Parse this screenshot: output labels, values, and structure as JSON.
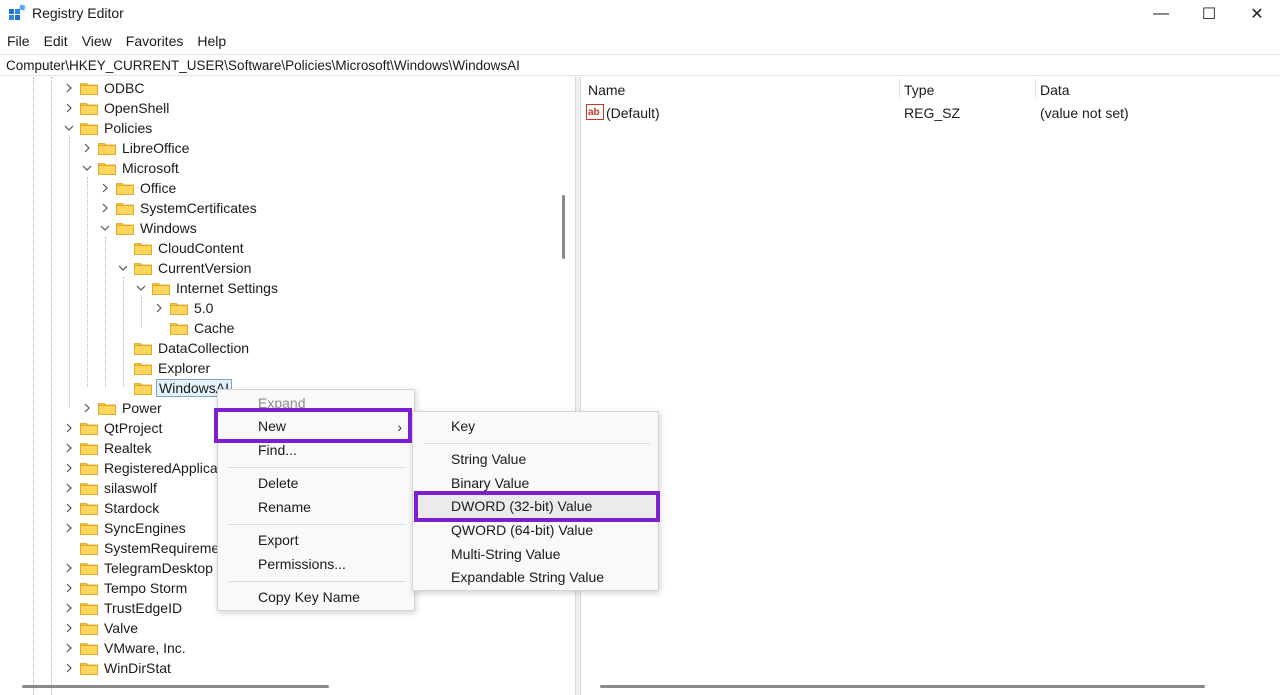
{
  "window": {
    "title": "Registry Editor",
    "controls": {
      "minimize": "—",
      "maximize": "☐",
      "close": "✕"
    }
  },
  "menubar": [
    "File",
    "Edit",
    "View",
    "Favorites",
    "Help"
  ],
  "address": "Computer\\HKEY_CURRENT_USER\\Software\\Policies\\Microsoft\\Windows\\WindowsAI",
  "tree": [
    {
      "label": "ODBC",
      "chevron": "right"
    },
    {
      "label": "OpenShell",
      "chevron": "right"
    },
    {
      "label": "Policies",
      "chevron": "down"
    },
    {
      "label": "LibreOffice",
      "chevron": "right"
    },
    {
      "label": "Microsoft",
      "chevron": "down"
    },
    {
      "label": "Office",
      "chevron": "right"
    },
    {
      "label": "SystemCertificates",
      "chevron": "right"
    },
    {
      "label": "Windows",
      "chevron": "down"
    },
    {
      "label": "CloudContent",
      "chevron": "none"
    },
    {
      "label": "CurrentVersion",
      "chevron": "down"
    },
    {
      "label": "Internet Settings",
      "chevron": "down"
    },
    {
      "label": "5.0",
      "chevron": "right"
    },
    {
      "label": "Cache",
      "chevron": "none"
    },
    {
      "label": "DataCollection",
      "chevron": "none"
    },
    {
      "label": "Explorer",
      "chevron": "none"
    },
    {
      "label": "WindowsAI",
      "chevron": "none",
      "selected": true
    },
    {
      "label": "Power",
      "chevron": "right"
    },
    {
      "label": "QtProject",
      "chevron": "right"
    },
    {
      "label": "Realtek",
      "chevron": "right"
    },
    {
      "label": "RegisteredApplications",
      "chevron": "right"
    },
    {
      "label": "silaswolf",
      "chevron": "right"
    },
    {
      "label": "Stardock",
      "chevron": "right"
    },
    {
      "label": "SyncEngines",
      "chevron": "right"
    },
    {
      "label": "SystemRequirementsLab",
      "chevron": "none"
    },
    {
      "label": "TelegramDesktop",
      "chevron": "right"
    },
    {
      "label": "Tempo Storm",
      "chevron": "right"
    },
    {
      "label": "TrustEdgeID",
      "chevron": "right"
    },
    {
      "label": "Valve",
      "chevron": "right"
    },
    {
      "label": "VMware, Inc.",
      "chevron": "right"
    },
    {
      "label": "WinDirStat",
      "chevron": "right"
    }
  ],
  "list": {
    "columns": {
      "name": "Name",
      "type": "Type",
      "data": "Data"
    },
    "rows": [
      {
        "name": "(Default)",
        "type": "REG_SZ",
        "data": "(value not set)",
        "icon": "string-value-icon"
      }
    ]
  },
  "context_menu": {
    "expand": "Expand",
    "new": "New",
    "find": "Find...",
    "delete": "Delete",
    "rename": "Rename",
    "export": "Export",
    "permissions": "Permissions...",
    "copy_key_name": "Copy Key Name",
    "submenu_arrow": "›"
  },
  "submenu": {
    "key": "Key",
    "string_value": "String Value",
    "binary_value": "Binary Value",
    "dword_value": "DWORD (32-bit) Value",
    "qword_value": "QWORD (64-bit) Value",
    "multi_string_value": "Multi-String Value",
    "expandable_string_value": "Expandable String Value"
  },
  "colors": {
    "folder": "#f3c242",
    "highlight": "#7b1fd0",
    "selection": "#e5f1fb"
  }
}
